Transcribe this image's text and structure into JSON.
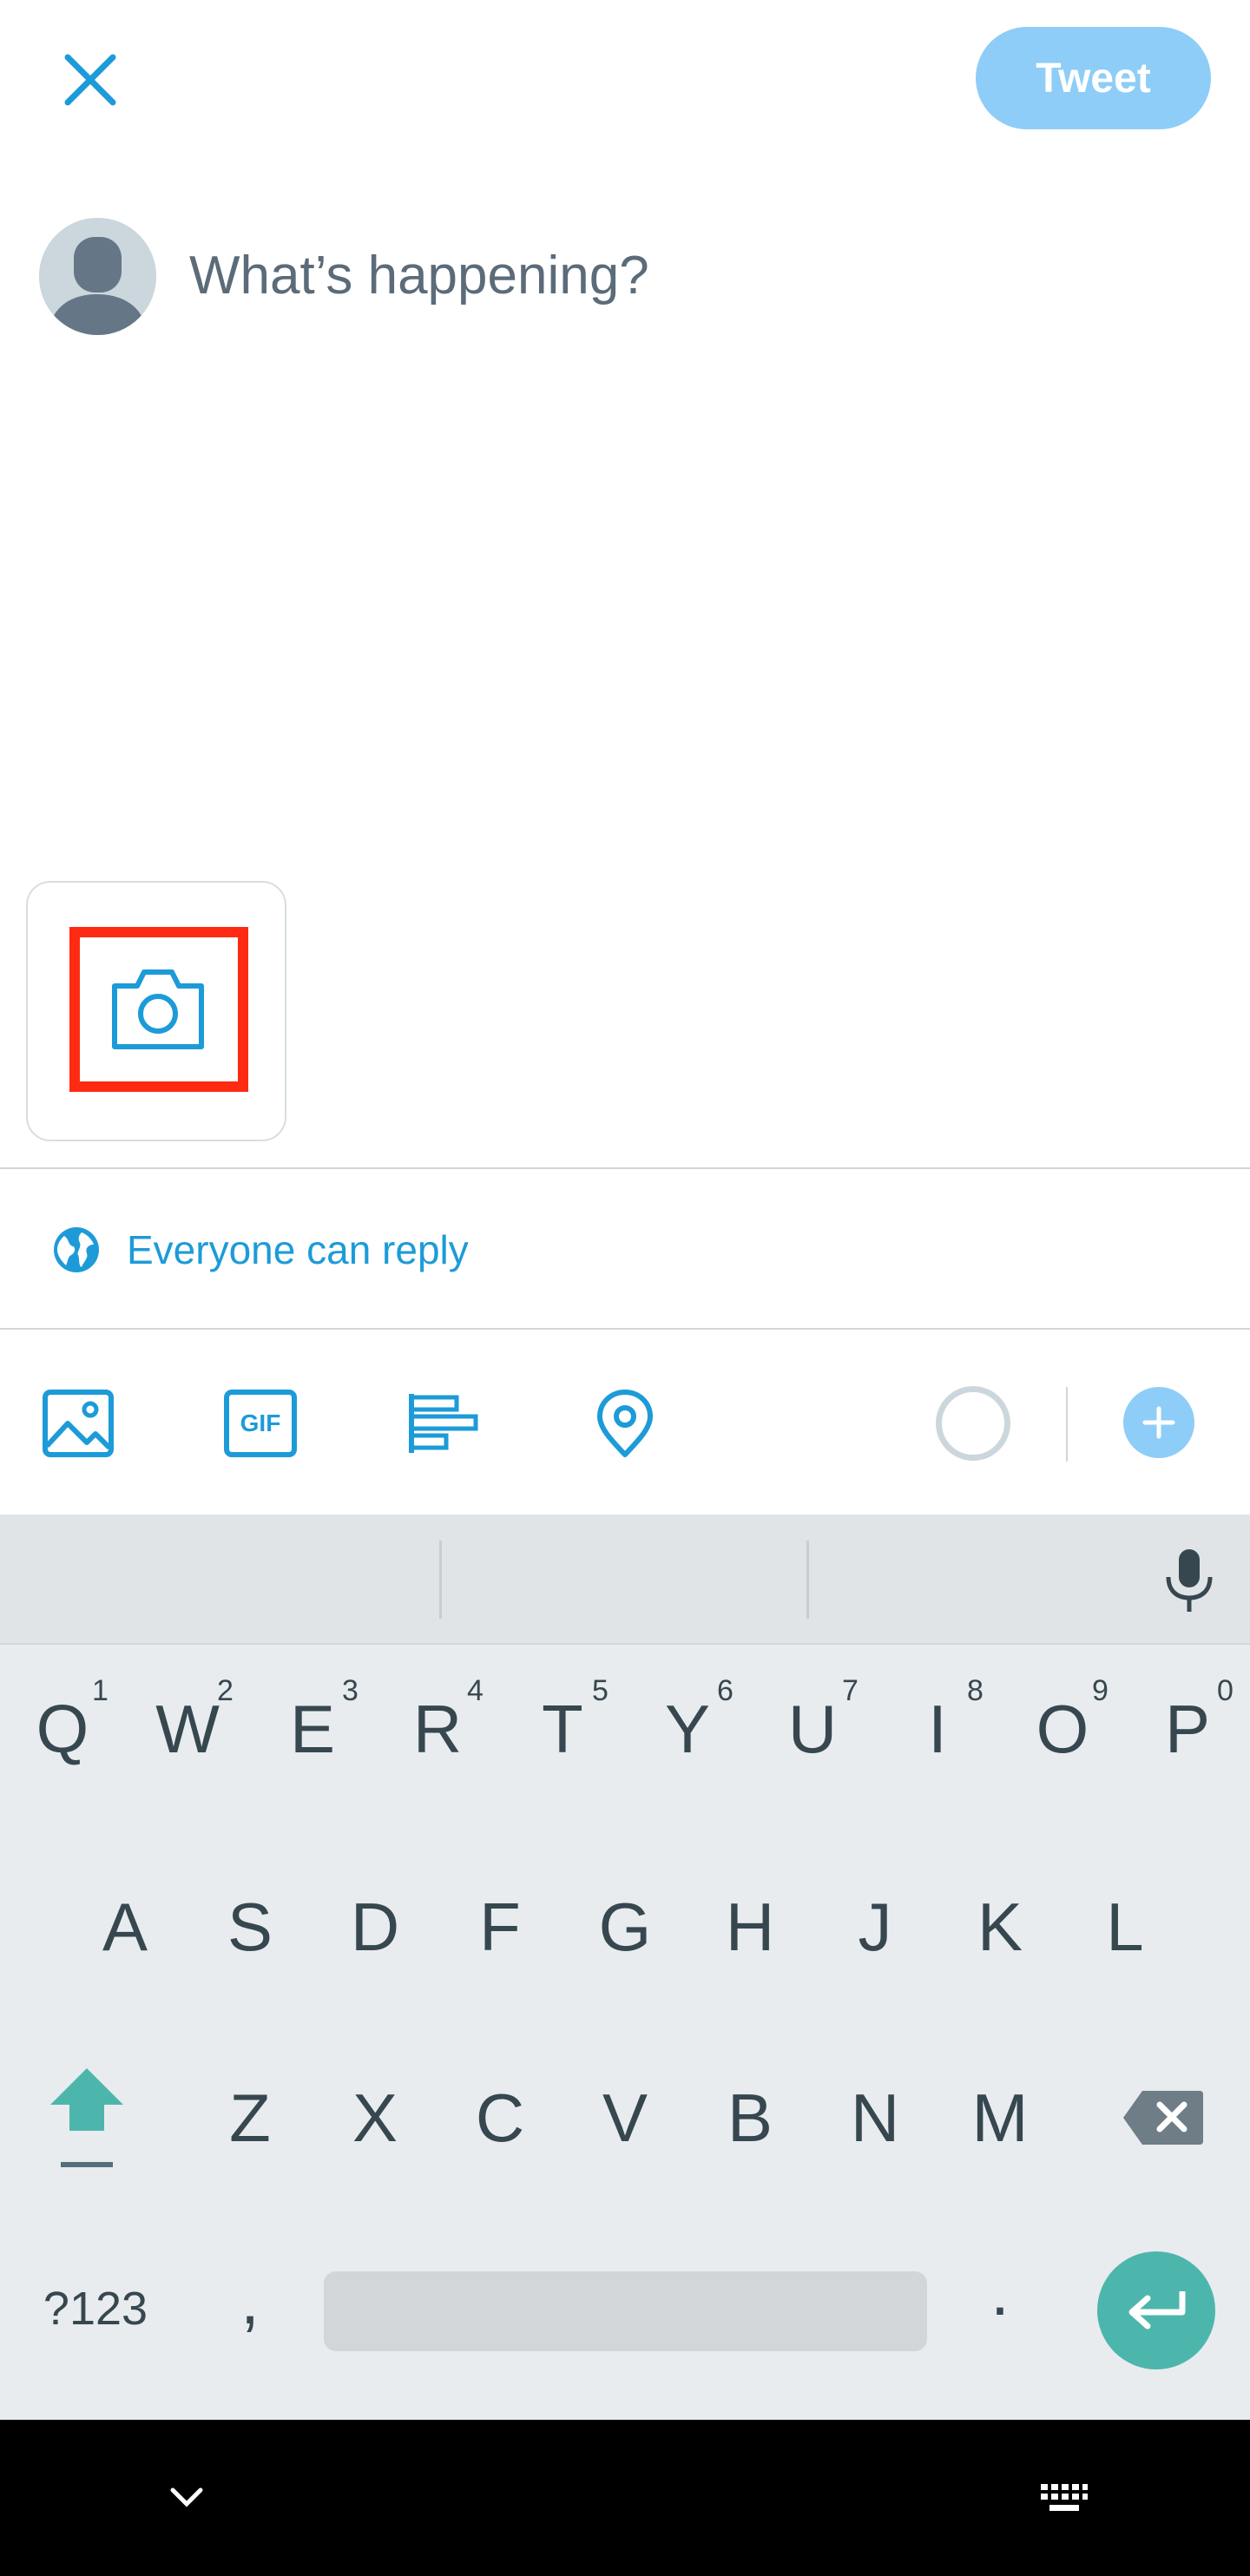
{
  "header": {
    "close_icon": "close-icon",
    "tweet_label": "Tweet"
  },
  "composer": {
    "placeholder": "What’s happening?",
    "value": ""
  },
  "media": {
    "camera_icon": "camera-icon"
  },
  "reply_setting": {
    "label": "Everyone can reply",
    "icon": "globe-icon"
  },
  "toolbar": {
    "items": [
      "image-icon",
      "gif-icon",
      "poll-icon",
      "location-icon"
    ],
    "gif_label": "GIF"
  },
  "keyboard": {
    "row1": [
      {
        "key": "Q",
        "hint": "1"
      },
      {
        "key": "W",
        "hint": "2"
      },
      {
        "key": "E",
        "hint": "3"
      },
      {
        "key": "R",
        "hint": "4"
      },
      {
        "key": "T",
        "hint": "5"
      },
      {
        "key": "Y",
        "hint": "6"
      },
      {
        "key": "U",
        "hint": "7"
      },
      {
        "key": "I",
        "hint": "8"
      },
      {
        "key": "O",
        "hint": "9"
      },
      {
        "key": "P",
        "hint": "0"
      }
    ],
    "row2": [
      "A",
      "S",
      "D",
      "F",
      "G",
      "H",
      "J",
      "K",
      "L"
    ],
    "row3": [
      "Z",
      "X",
      "C",
      "V",
      "B",
      "N",
      "M"
    ],
    "symbols_label": "?123",
    "comma": ",",
    "period": "."
  },
  "colors": {
    "accent": "#1d9bd8",
    "tweet_button": "#8ecdf7",
    "highlight": "#ff2a12",
    "keyboard_accent": "#4db6ac"
  }
}
